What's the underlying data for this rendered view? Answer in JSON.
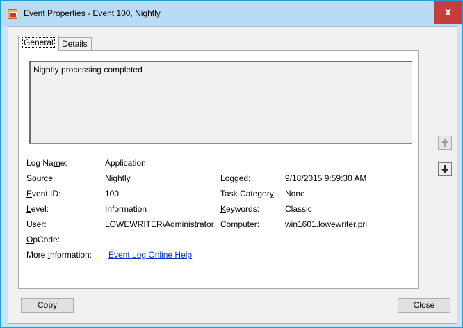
{
  "window": {
    "title": "Event Properties - Event 100, Nightly",
    "close_glyph": "x",
    "accent_color": "#1f9bd6"
  },
  "tabs": [
    {
      "label": "General",
      "active": true
    },
    {
      "label": "Details",
      "active": false
    }
  ],
  "description": "Nightly processing completed",
  "fields": {
    "log_name": {
      "label": "Log Name:",
      "value": "Application"
    },
    "source": {
      "label": "Source:",
      "value": "Nightly"
    },
    "logged": {
      "label": "Logged:",
      "value": "9/18/2015 9:59:30 AM"
    },
    "event_id": {
      "label": "Event ID:",
      "value": "100"
    },
    "task_category": {
      "label": "Task Category:",
      "value": "None"
    },
    "level": {
      "label": "Level:",
      "value": "Information"
    },
    "keywords": {
      "label": "Keywords:",
      "value": "Classic"
    },
    "user": {
      "label": "User:",
      "value": "LOWEWRITER\\Administrator"
    },
    "computer": {
      "label": "Computer:",
      "value": "win1601.lowewriter.pri"
    },
    "opcode": {
      "label": "OpCode:",
      "value": ""
    },
    "more_info": {
      "label": "More Information:",
      "link": "Event Log Online Help"
    }
  },
  "side_buttons": {
    "up": {
      "icon": "up-arrow-icon",
      "enabled": false
    },
    "down": {
      "icon": "down-arrow-icon",
      "enabled": true
    }
  },
  "buttons": {
    "copy": "Copy",
    "close": "Close"
  }
}
